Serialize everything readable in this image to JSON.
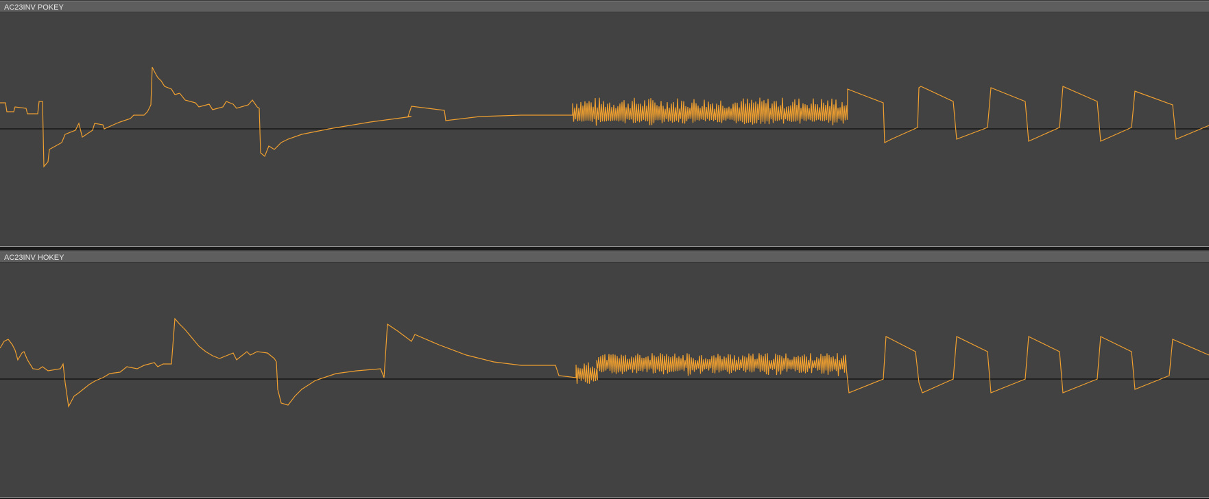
{
  "colors": {
    "background": "#424242",
    "header": "#5e5e5e",
    "waveform": "#f0a030",
    "baseline": "#000000"
  },
  "tracks": [
    {
      "label": "AC23INV POKEY"
    },
    {
      "label": "AC23INV HOKEY"
    }
  ]
}
